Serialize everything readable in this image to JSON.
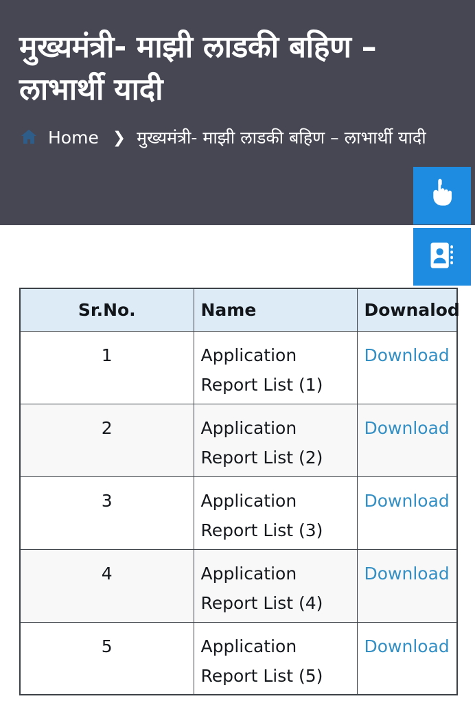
{
  "header": {
    "title": "मुख्यमंत्री- माझी लाडकी बहिण – लाभार्थी यादी",
    "background_color": "#474754",
    "title_color": "#ffffff"
  },
  "breadcrumb": {
    "home_icon": "home-icon",
    "home_label": "Home",
    "separator": "❯",
    "current": "मुख्यमंत्री- माझी लाडकी बहिण – लाभार्थी यादी"
  },
  "floating_buttons": [
    {
      "icon": "accessibility-hand-icon",
      "color": "#1e8ce0"
    },
    {
      "icon": "contact-card-icon",
      "color": "#1e8ce0"
    }
  ],
  "table": {
    "header_background": "#dcebf5",
    "border_color": "#3c4148",
    "link_color": "#3490c4",
    "row_alt_background": "#f8f8f8",
    "columns": [
      "Sr.No.",
      "Name",
      "Downalod"
    ],
    "rows": [
      {
        "sr": "1",
        "name": "Application Report List (1)",
        "download": "Download"
      },
      {
        "sr": "2",
        "name": "Application Report List (2)",
        "download": "Download"
      },
      {
        "sr": "3",
        "name": "Application Report List (3)",
        "download": "Download"
      },
      {
        "sr": "4",
        "name": "Application Report List (4)",
        "download": "Download"
      },
      {
        "sr": "5",
        "name": "Application Report List (5)",
        "download": "Download"
      }
    ]
  }
}
